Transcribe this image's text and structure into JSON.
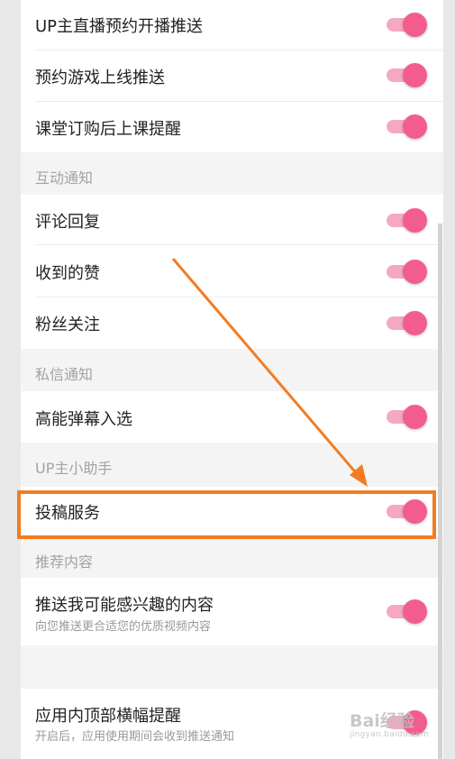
{
  "settings": {
    "live_push": {
      "label": "UP主直播预约开播推送",
      "enabled": true
    },
    "game_push": {
      "label": "预约游戏上线推送",
      "enabled": true
    },
    "class_reminder": {
      "label": "课堂订购后上课提醒",
      "enabled": true
    },
    "interaction_section": "互动通知",
    "comment_reply": {
      "label": "评论回复",
      "enabled": true
    },
    "likes": {
      "label": "收到的赞",
      "enabled": true
    },
    "fans_follow": {
      "label": "粉丝关注",
      "enabled": true
    },
    "message_section": "私信通知",
    "danmaku_selected": {
      "label": "高能弹幕入选",
      "enabled": true
    },
    "up_helper_section": "UP主小助手",
    "submission_service": {
      "label": "投稿服务",
      "enabled": true
    },
    "recommend_section": "推荐内容",
    "interest_push": {
      "label": "推送我可能感兴趣的内容",
      "description": "向您推送更合适您的优质视频内容",
      "enabled": true
    },
    "banner_reminder": {
      "label": "应用内顶部横幅提醒",
      "description": "开启后，应用使用期间会收到推送通知",
      "enabled": true
    }
  },
  "watermark": {
    "text": "Bai经验",
    "url": "jingyan.baidu.com"
  },
  "colors": {
    "toggle_on": "#f25d8e",
    "toggle_track": "#f5a9c0",
    "highlight": "#f37c22"
  }
}
